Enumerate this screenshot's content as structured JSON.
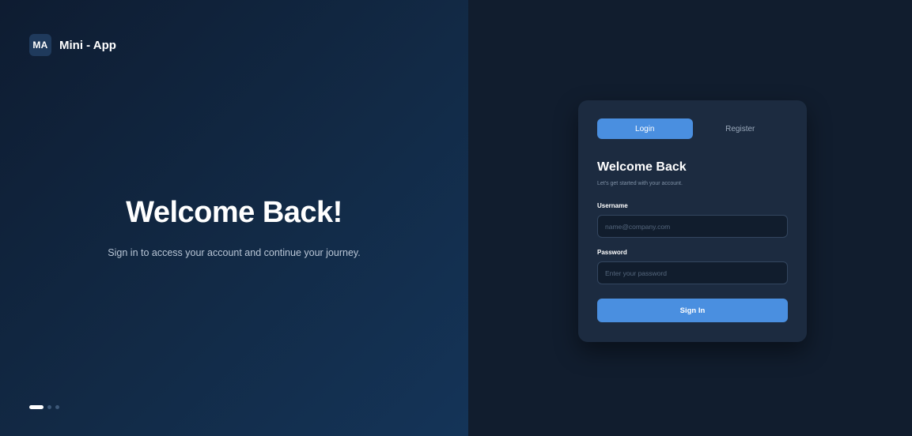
{
  "brand": {
    "badge": "MA",
    "name": "Mini - App"
  },
  "hero": {
    "title": "Welcome Back!",
    "subtitle": "Sign in to access your account and continue your journey."
  },
  "carousel": {
    "count": 3,
    "active_index": 0
  },
  "auth": {
    "tabs": [
      {
        "label": "Login",
        "active": true
      },
      {
        "label": "Register",
        "active": false
      }
    ],
    "title": "Welcome Back",
    "subtitle": "Let's get started with your account.",
    "username": {
      "label": "Username",
      "placeholder": "name@company.com",
      "value": ""
    },
    "password": {
      "label": "Password",
      "placeholder": "Enter your password",
      "value": ""
    },
    "submit_label": "Sign In"
  },
  "colors": {
    "accent": "#4a8fe0",
    "card_bg": "#1c2b40",
    "page_bg": "#111d2e"
  }
}
